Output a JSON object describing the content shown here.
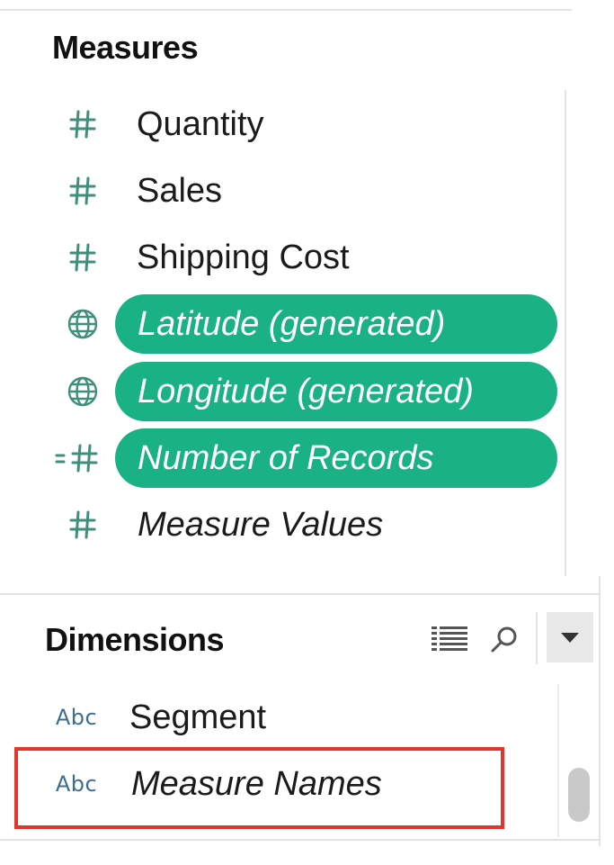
{
  "measures": {
    "title": "Measures",
    "items": [
      {
        "label": "Quantity",
        "icon": "hash-icon",
        "italic": false,
        "selected": false
      },
      {
        "label": "Sales",
        "icon": "hash-icon",
        "italic": false,
        "selected": false
      },
      {
        "label": "Shipping Cost",
        "icon": "hash-icon",
        "italic": false,
        "selected": false
      },
      {
        "label": "Latitude (generated)",
        "icon": "globe-icon",
        "italic": true,
        "selected": true
      },
      {
        "label": "Longitude (generated)",
        "icon": "globe-icon",
        "italic": true,
        "selected": true
      },
      {
        "label": "Number of Records",
        "icon": "calculated-hash-icon",
        "italic": true,
        "selected": true
      },
      {
        "label": "Measure Values",
        "icon": "hash-icon",
        "italic": true,
        "selected": false
      }
    ]
  },
  "dimensions": {
    "title": "Dimensions",
    "toolbar": {
      "view_icon": "list-view-icon",
      "search_icon": "search-icon",
      "menu_icon": "dropdown-arrow-icon"
    },
    "items": [
      {
        "label": "Segment",
        "type_label": "Abc",
        "italic": false,
        "highlighted": false
      },
      {
        "label": "Measure Names",
        "type_label": "Abc",
        "italic": true,
        "highlighted": true
      }
    ]
  },
  "colors": {
    "pill": "#1ab285",
    "field_icon": "#3f8f7a",
    "abc": "#3d6e8f",
    "highlight": "#e2362c"
  }
}
